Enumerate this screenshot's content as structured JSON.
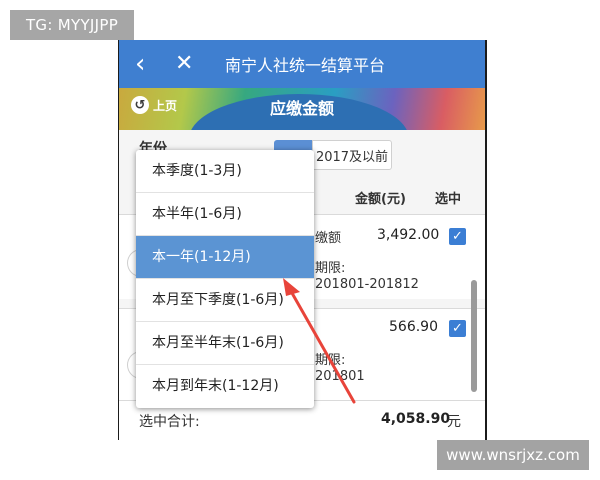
{
  "watermarks": {
    "top": "TG: MYYJJPP",
    "bottom": "www.wnsrjxz.com"
  },
  "navbar": {
    "title": "南宁人社统一结算平台",
    "back_icon": "chevron-left-icon",
    "close_icon": "close-icon"
  },
  "banner": {
    "prev_label": "上页",
    "title": "应缴金额"
  },
  "filters": {
    "year_label": "年份",
    "year_option_prev": "2017及以前"
  },
  "table": {
    "headers": {
      "amount": "金额(元)",
      "selected": "选中"
    },
    "rows": [
      {
        "title_fragment": "缴额",
        "amount": "3,492.00",
        "period_label_fragment": "期限:",
        "period_value_fragment": "201801-201812",
        "checked": true
      },
      {
        "amount": "566.90",
        "period_label_fragment": "期限:",
        "period_value_fragment": "201801",
        "checked": true
      }
    ]
  },
  "footer": {
    "total_label": "选中合计:",
    "total_amount": "4,058.90",
    "unit": "元"
  },
  "dropdown": {
    "options": [
      "本季度(1-3月)",
      "本半年(1-6月)",
      "本一年(1-12月)",
      "本月至下季度(1-6月)",
      "本月至半年末(1-6月)",
      "本月到年末(1-12月)"
    ],
    "selected": "本一年(1-12月)"
  },
  "colors": {
    "navbar": "#3f7fd0",
    "highlight": "#5b94d3",
    "checkbox": "#3b7ed4",
    "arrow": "#e8443a"
  }
}
